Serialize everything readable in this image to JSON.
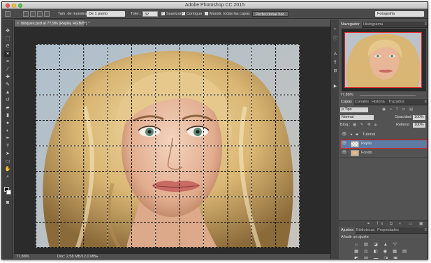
{
  "window": {
    "title": "Adobe Photoshop CC 2015"
  },
  "options_bar": {
    "sample_size_label": "Tam. de muestra:",
    "sample_size_value": "De 1 punto",
    "tolerance_label": "Toler.:",
    "tolerance_value": "32",
    "antialias_label": "Suavizar",
    "contiguous_label": "Contiguo",
    "sample_all_label": "Muestr. todas las capas",
    "refine_edge_label": "Perfeccionar bor.",
    "workspace_value": "Fotografía"
  },
  "document": {
    "tab_label": "bloques.psd al 77,9% (Rejilla, RGB/8*) *",
    "tab_close": "×",
    "zoom": "77,88%",
    "doc_info": "Doc: 2,58 MB/12,0 MB"
  },
  "navigator": {
    "tabs": [
      "Navegador",
      "Histograma"
    ],
    "zoom": "77,88%"
  },
  "layers_panel": {
    "tabs": [
      "Capas",
      "Canales",
      "Historia",
      "Trazados"
    ],
    "filter_value": "ρ Tipo",
    "blend_mode": "Normal",
    "opacity_label": "Opacidad:",
    "opacity_value": "100%",
    "lock_label": "Bloq.:",
    "fill_label": "Relleno:",
    "fill_value": "100%",
    "layers": [
      {
        "name": "Tutorial"
      },
      {
        "name": "Rejilla"
      },
      {
        "name": "Fondo"
      }
    ]
  },
  "adjustments_panel": {
    "tabs": [
      "Ajustes",
      "Bibliotecas",
      "Propiedades"
    ],
    "title": "Añadir un ajuste"
  },
  "colors": {
    "selection_highlight": "#e3272b",
    "selected_layer": "#5f7aa3"
  }
}
